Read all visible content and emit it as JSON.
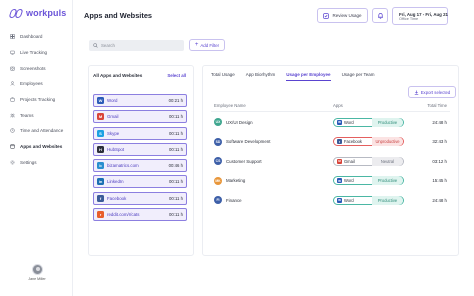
{
  "brand": {
    "name": "workpuls"
  },
  "sidebar": {
    "items": [
      {
        "label": "Dashboard",
        "icon": "dashboard-icon"
      },
      {
        "label": "Live Tracking",
        "icon": "live-tracking-icon"
      },
      {
        "label": "Screenshots",
        "icon": "screenshots-icon"
      },
      {
        "label": "Employees",
        "icon": "employees-icon"
      },
      {
        "label": "Projects Tracking",
        "icon": "projects-icon"
      },
      {
        "label": "Teams",
        "icon": "teams-icon"
      },
      {
        "label": "Time and Attendance",
        "icon": "attendance-icon"
      },
      {
        "label": "Apps and Websites",
        "icon": "apps-icon",
        "active": true
      },
      {
        "label": "Settings",
        "icon": "settings-icon"
      }
    ],
    "user": {
      "name": "Jane Miller"
    }
  },
  "header": {
    "title": "Apps and Websites",
    "review_label": "Review Usage",
    "date_range": "Fri, Aug 17 - Fri, Aug 21",
    "date_sub": "Office Time"
  },
  "search": {
    "placeholder": "Search"
  },
  "filter": {
    "label": "Add Filter"
  },
  "left_panel": {
    "title": "All Apps and Websites",
    "select_label": "Select all",
    "apps": [
      {
        "name": "Word",
        "time": "00:21 h",
        "color": "#2b5bb8",
        "glyph": "W"
      },
      {
        "name": "Gmail",
        "time": "00:11 h",
        "color": "#d9443a",
        "glyph": "M"
      },
      {
        "name": "Skype",
        "time": "00:11 h",
        "color": "#1da1e2",
        "glyph": "S"
      },
      {
        "name": "HubSpot",
        "time": "00:11 h",
        "color": "#2b2f3a",
        "glyph": "H"
      },
      {
        "name": "bizamatrics.com",
        "time": "00:46 h",
        "color": "#2a8fcf",
        "glyph": "b"
      },
      {
        "name": "LinkedIn",
        "time": "00:11 h",
        "color": "#1b6fb3",
        "glyph": "in"
      },
      {
        "name": "Facebook",
        "time": "00:11 h",
        "color": "#3b5b98",
        "glyph": "f"
      },
      {
        "name": "reddit.com/r/cats",
        "time": "00:11 h",
        "color": "#e85d2c",
        "glyph": "r"
      }
    ]
  },
  "right_panel": {
    "tabs": [
      {
        "label": "Total Usage"
      },
      {
        "label": "App Biorhythm"
      },
      {
        "label": "Usage per Employee",
        "active": true
      },
      {
        "label": "Usage per Team"
      }
    ],
    "export_label": "Export selected",
    "columns": {
      "name": "Employee Name",
      "apps": "Apps",
      "time": "Total Time"
    },
    "rows": [
      {
        "initials": "UX",
        "avatar_color": "#3fa68f",
        "name": "UX/UI Design",
        "app": "Word",
        "app_color": "#2b5bb8",
        "app_glyph": "W",
        "status": "Productive",
        "status_class": "productive",
        "time": "24:48 h"
      },
      {
        "initials": "SD",
        "avatar_color": "#3d5fa8",
        "name": "Software Development",
        "app": "Facebook",
        "app_color": "#3b5b98",
        "app_glyph": "f",
        "status": "Unproductive",
        "status_class": "unproductive",
        "time": "32:43 h"
      },
      {
        "initials": "CS",
        "avatar_color": "#3d5fa8",
        "name": "Customer Support",
        "app": "Gmail",
        "app_color": "#d9443a",
        "app_glyph": "M",
        "status": "Neutral",
        "status_class": "neutral",
        "time": "03:12 h"
      },
      {
        "initials": "MK",
        "avatar_color": "#e8963a",
        "name": "Marketing",
        "app": "Word",
        "app_color": "#2b5bb8",
        "app_glyph": "W",
        "status": "Productive",
        "status_class": "productive",
        "time": "15:45 h"
      },
      {
        "initials": "FI",
        "avatar_color": "#3d5fa8",
        "name": "Finance",
        "app": "Word",
        "app_color": "#2b5bb8",
        "app_glyph": "W",
        "status": "Productive",
        "status_class": "productive",
        "time": "24:48 h"
      }
    ]
  },
  "colors": {
    "accent": "#5a44d0",
    "productive": "#4bb7a4",
    "unproductive": "#e45f5f",
    "neutral": "#b7bac3"
  }
}
